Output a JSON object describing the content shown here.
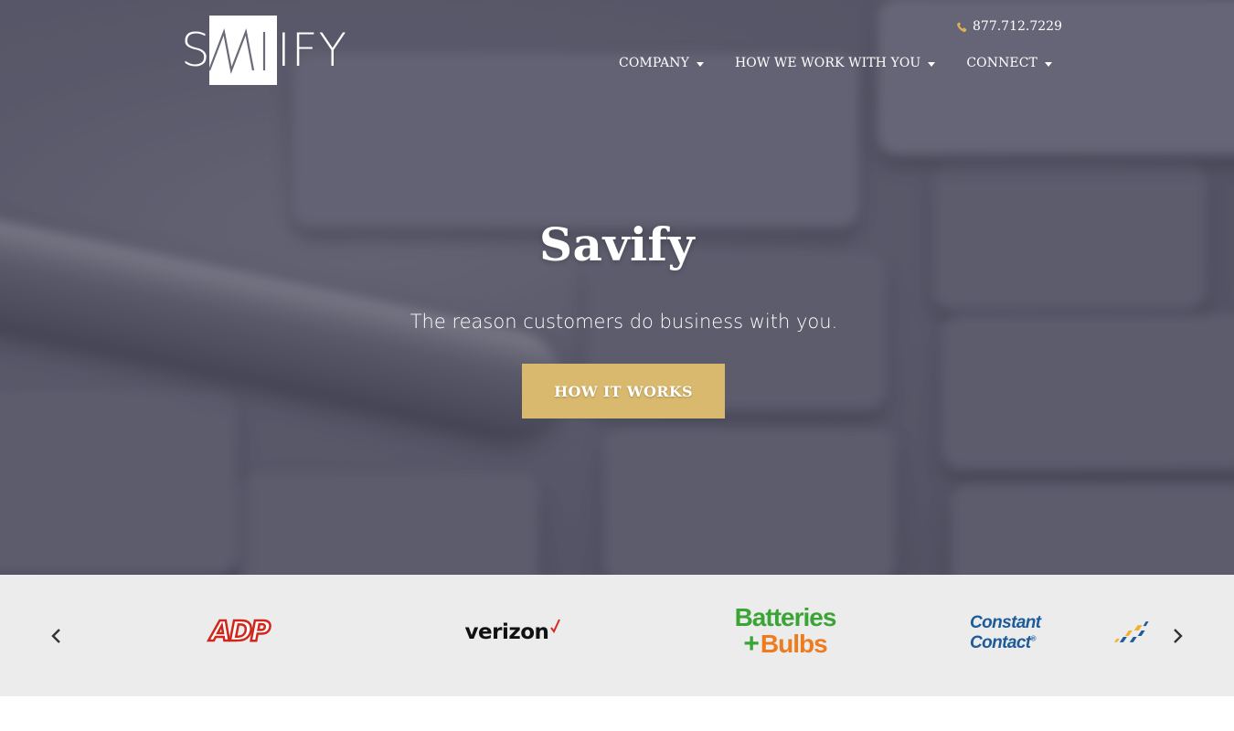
{
  "header": {
    "logo_text": "SAVIFY",
    "phone": "877.712.7229",
    "nav": [
      {
        "label": "COMPANY"
      },
      {
        "label": "HOW WE WORK WITH YOU"
      },
      {
        "label": "CONNECT"
      }
    ]
  },
  "hero": {
    "title": "Savify",
    "subtitle": "The reason customers do business with you.",
    "cta_label": "HOW IT WORKS"
  },
  "logo_strip": {
    "logos": [
      {
        "name": "ADP",
        "text": "ADP"
      },
      {
        "name": "Verizon",
        "text": "verizon"
      },
      {
        "name": "Batteries Plus Bulbs",
        "line1": "Batteries",
        "plus": "+",
        "line2": "Bulbs"
      },
      {
        "name": "Constant Contact",
        "text": "Constant Contact"
      }
    ]
  },
  "colors": {
    "accent": "#d9b96e",
    "strip_bg": "#ececec",
    "adp_red": "#d0271d",
    "verizon_red": "#d52b1e",
    "bb_green": "#3aa535",
    "bb_orange": "#ee7b1e",
    "cc_blue": "#1d5b9b"
  },
  "icons": {
    "phone": "phone-icon",
    "prev": "chevron-left-icon",
    "next": "chevron-right-icon",
    "dropdown": "caret-down-icon"
  }
}
